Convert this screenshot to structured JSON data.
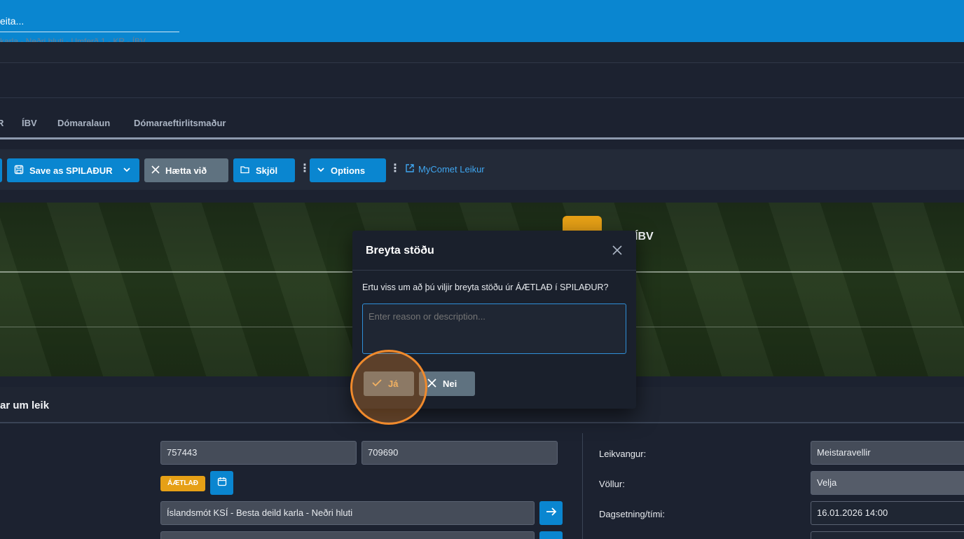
{
  "topbar": {
    "search_text": "eita...",
    "breadcrumb_ghost": "karla - Neðri hluti - Umferð 1 - KR - ÍBV"
  },
  "tabs": [
    "R",
    "ÍBV",
    "Dómaralaun",
    "Dómaraeftirlitsmaður"
  ],
  "toolbar": {
    "save_label": "Save as SPILAÐUR",
    "cancel_label": "Hætta við",
    "docs_label": "Skjöl",
    "options_label": "Options",
    "mycomet_label": "MyComet Leikur"
  },
  "hero": {
    "team_name": "ÍBV"
  },
  "section": {
    "title": "ar um leik"
  },
  "form": {
    "id1": "757443",
    "id2": "709690",
    "status_badge": "ÁÆTLAÐ",
    "competition": "Íslandsmót KSÍ - Besta deild karla - Neðri hluti",
    "labels": {
      "stadium": "Leikvangur:",
      "pitch": "Völlur:",
      "datetime": "Dagsetning/tími:"
    },
    "stadium": "Meistaravellir",
    "pitch": "Velja",
    "datetime": "16.01.2026 14:00"
  },
  "modal": {
    "title": "Breyta stöðu",
    "message": "Ertu viss um að þú viljir breyta stöðu úr ÁÆTLAÐ í SPILAÐUR?",
    "placeholder": "Enter reason or description...",
    "yes_label": "Já",
    "no_label": "Nei"
  },
  "colors": {
    "primary": "#0a86d0",
    "warning": "#e6a016",
    "secondary": "#5f7280",
    "highlight": "#f08a2c"
  }
}
